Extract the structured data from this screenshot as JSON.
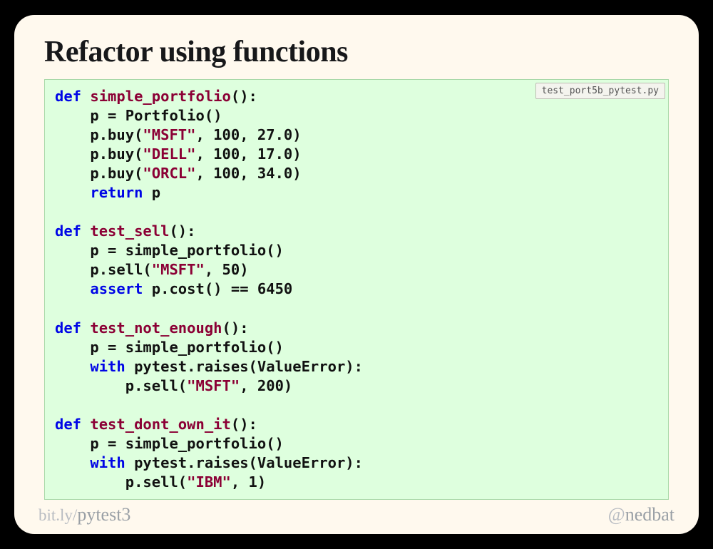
{
  "title": "Refactor using functions",
  "filename": "test_port5b_pytest.py",
  "code": {
    "l1": {
      "kw": "def",
      "fn": "simple_portfolio",
      "sig": "():"
    },
    "l2": "    p = Portfolio()",
    "l3a": "    p.buy(",
    "l3s": "\"MSFT\"",
    "l3b": ", 100, 27.0)",
    "l4a": "    p.buy(",
    "l4s": "\"DELL\"",
    "l4b": ", 100, 17.0)",
    "l5a": "    p.buy(",
    "l5s": "\"ORCL\"",
    "l5b": ", 100, 34.0)",
    "l6": {
      "kw": "return",
      "rest": " p"
    },
    "l8": {
      "kw": "def",
      "fn": "test_sell",
      "sig": "():"
    },
    "l9": "    p = simple_portfolio()",
    "l10a": "    p.sell(",
    "l10s": "\"MSFT\"",
    "l10b": ", 50)",
    "l11": {
      "kw": "assert",
      "rest": " p.cost() == 6450"
    },
    "l13": {
      "kw": "def",
      "fn": "test_not_enough",
      "sig": "():"
    },
    "l14": "    p = simple_portfolio()",
    "l15": {
      "kw": "with",
      "rest": " pytest.raises(ValueError):"
    },
    "l16a": "        p.sell(",
    "l16s": "\"MSFT\"",
    "l16b": ", 200)",
    "l18": {
      "kw": "def",
      "fn": "test_dont_own_it",
      "sig": "():"
    },
    "l19": "    p = simple_portfolio()",
    "l20": {
      "kw": "with",
      "rest": " pytest.raises(ValueError):"
    },
    "l21a": "        p.sell(",
    "l21s": "\"IBM\"",
    "l21b": ", 1)"
  },
  "footer": {
    "left_prefix": "bit.ly/",
    "left_main": "pytest3",
    "right_at": "@",
    "right_handle": "nedbat"
  },
  "chart_data": {
    "type": "table",
    "title": "Python source code shown on slide",
    "filename": "test_port5b_pytest.py",
    "source_lines": [
      "def simple_portfolio():",
      "    p = Portfolio()",
      "    p.buy(\"MSFT\", 100, 27.0)",
      "    p.buy(\"DELL\", 100, 17.0)",
      "    p.buy(\"ORCL\", 100, 34.0)",
      "    return p",
      "",
      "def test_sell():",
      "    p = simple_portfolio()",
      "    p.sell(\"MSFT\", 50)",
      "    assert p.cost() == 6450",
      "",
      "def test_not_enough():",
      "    p = simple_portfolio()",
      "    with pytest.raises(ValueError):",
      "        p.sell(\"MSFT\", 200)",
      "",
      "def test_dont_own_it():",
      "    p = simple_portfolio()",
      "    with pytest.raises(ValueError):",
      "        p.sell(\"IBM\", 1)"
    ]
  }
}
